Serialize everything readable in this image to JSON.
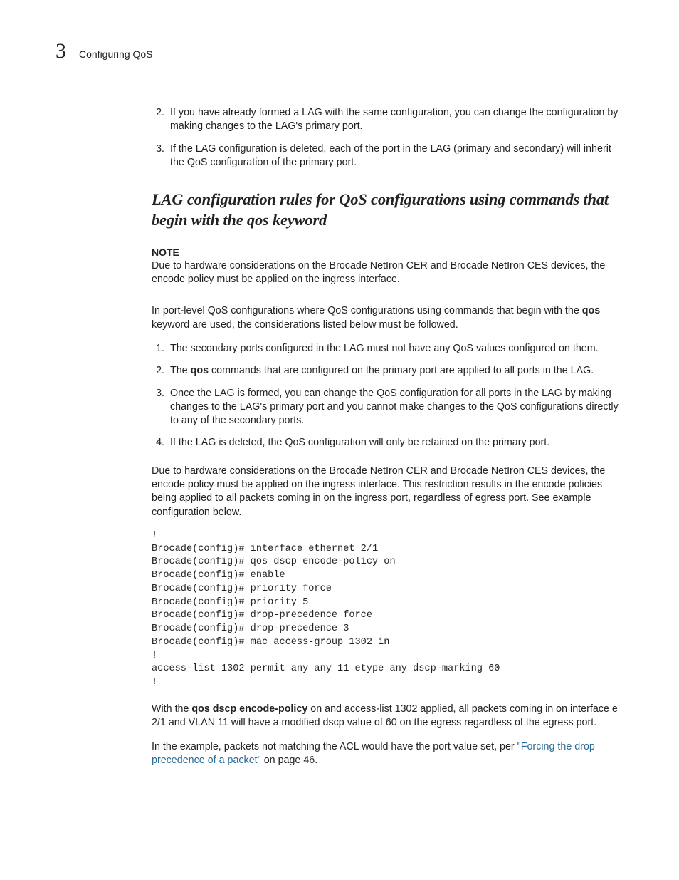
{
  "header": {
    "chapter_number": "3",
    "running_title": "Configuring QoS"
  },
  "list_a": {
    "start": 2,
    "items": [
      "If you have already formed a LAG with the same configuration, you can change the configuration by making changes to the LAG's primary port.",
      "If the LAG configuration is deleted, each of the port in the LAG (primary and secondary) will inherit the QoS configuration of the primary port."
    ]
  },
  "section_title": "LAG configuration rules for QoS configurations using commands that begin with the qos keyword",
  "note": {
    "label": "NOTE",
    "body": "Due to hardware considerations on the Brocade NetIron CER and Brocade NetIron CES devices, the encode policy must be applied on the ingress interface."
  },
  "intro_para": {
    "pre": "In port-level QoS configurations where QoS configurations using commands that begin with the ",
    "bold": "qos",
    "post": " keyword are used, the considerations listed below must be followed."
  },
  "list_b": {
    "items": [
      {
        "pre": "The secondary ports configured in the LAG must not have any QoS values configured on them."
      },
      {
        "pre": "The ",
        "bold": "qos",
        "post": " commands that are configured on the primary port are applied to all ports in the LAG."
      },
      {
        "pre": "Once the LAG is formed, you can change the QoS configuration for all ports in the LAG by making changes to the LAG's primary port and you cannot make changes to the QoS configurations directly to any of the secondary ports."
      },
      {
        "pre": "If the LAG is deleted, the QoS configuration will only be retained on the primary port."
      }
    ]
  },
  "para_hw": "Due to hardware considerations on the Brocade NetIron CER and Brocade NetIron CES devices, the encode policy must be applied on the ingress interface. This restriction results in the encode policies being applied to all packets coming in on the ingress port, regardless of egress port. See example configuration below.",
  "code_block": "!\nBrocade(config)# interface ethernet 2/1\nBrocade(config)# qos dscp encode-policy on\nBrocade(config)# enable\nBrocade(config)# priority force\nBrocade(config)# priority 5\nBrocade(config)# drop-precedence force\nBrocade(config)# drop-precedence 3\nBrocade(config)# mac access-group 1302 in\n!\naccess-list 1302 permit any any 11 etype any dscp-marking 60\n!",
  "para_with": {
    "pre": "With the ",
    "bold": "qos dscp encode-policy",
    "post": " on and access-list 1302 applied, all packets coming in on interface e 2/1 and VLAN 11 will have a modified dscp value of 60 on the egress regardless of the egress port."
  },
  "para_example": {
    "pre": "In the example, packets not matching the ACL would have the port value set, per ",
    "link": "\"Forcing the drop precedence of a packet\"",
    "post1": " on page 46."
  }
}
